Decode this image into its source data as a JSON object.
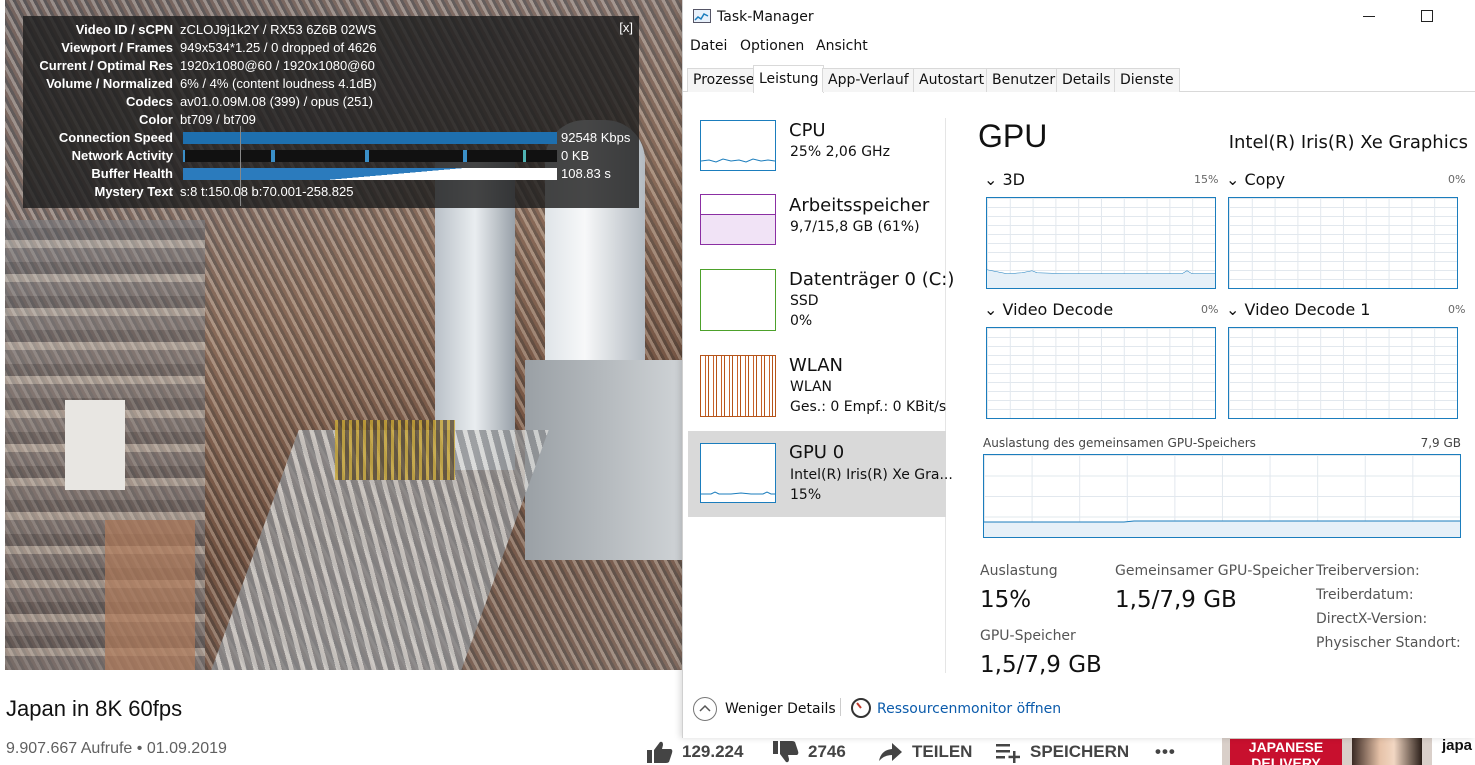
{
  "stats": {
    "close": "[x]",
    "rows": [
      {
        "label": "Video ID / sCPN",
        "value": "zCLOJ9j1k2Y / RX53 6Z6B 02WS"
      },
      {
        "label": "Viewport / Frames",
        "value": "949x534*1.25 / 0 dropped of 4626"
      },
      {
        "label": "Current / Optimal Res",
        "value": "1920x1080@60 / 1920x1080@60"
      },
      {
        "label": "Volume / Normalized",
        "value": "6% / 4% (content loudness 4.1dB)"
      },
      {
        "label": "Codecs",
        "value": "av01.0.09M.08 (399) / opus (251)"
      },
      {
        "label": "Color",
        "value": "bt709 / bt709"
      },
      {
        "label": "Connection Speed",
        "value": "92548 Kbps"
      },
      {
        "label": "Network Activity",
        "value": "0 KB"
      },
      {
        "label": "Buffer Health",
        "value": "108.83 s"
      },
      {
        "label": "Mystery Text",
        "value": "s:8 t:150.08 b:70.001-258.825"
      }
    ]
  },
  "video": {
    "title": "Japan in 8K 60fps",
    "meta": "9.907.667 Aufrufe • 01.09.2019",
    "actions": {
      "like": "129.224",
      "dislike": "2746",
      "share": "TEILEN",
      "save": "SPEICHERN",
      "more": "•••"
    }
  },
  "recommendation": {
    "thumb_text": "JAPANESE DELIVERY",
    "title": "japa"
  },
  "taskmanager": {
    "title": "Task-Manager",
    "menu": [
      "Datei",
      "Optionen",
      "Ansicht"
    ],
    "tabs": [
      "Prozesse",
      "Leistung",
      "App-Verlauf",
      "Autostart",
      "Benutzer",
      "Details",
      "Dienste"
    ],
    "active_tab": "Leistung",
    "resources": [
      {
        "name": "CPU",
        "line2": "25%  2,06 GHz",
        "line3": "",
        "color": "#1b7dbd"
      },
      {
        "name": "Arbeitsspeicher",
        "line2": "9,7/15,8 GB (61%)",
        "line3": "",
        "color": "#8b2fa3"
      },
      {
        "name": "Datenträger 0 (C:)",
        "line2": "SSD",
        "line3": "0%",
        "color": "#4da12b"
      },
      {
        "name": "WLAN",
        "line2": "WLAN",
        "line3": "Ges.: 0  Empf.: 0 KBit/s",
        "color": "#b5541a"
      },
      {
        "name": "GPU 0",
        "line2": "Intel(R) Iris(R) Xe Gra...",
        "line3": "15%",
        "color": "#1b7dbd"
      }
    ],
    "gpu": {
      "heading": "GPU",
      "model": "Intel(R) Iris(R) Xe Graphics",
      "engines": [
        {
          "label": "3D",
          "pct": "15%"
        },
        {
          "label": "Copy",
          "pct": "0%"
        },
        {
          "label": "Video Decode",
          "pct": "0%"
        },
        {
          "label": "Video Decode 1",
          "pct": "0%"
        }
      ],
      "shared_label": "Auslastung des gemeinsamen GPU-Speichers",
      "shared_max": "7,9 GB",
      "stats": {
        "util_label": "Auslastung",
        "util_value": "15%",
        "shared_mem_label": "Gemeinsamer GPU-Speicher",
        "shared_mem_value": "1,5/7,9 GB",
        "gpu_mem_label": "GPU-Speicher",
        "gpu_mem_value": "1,5/7,9 GB",
        "driver_version": "Treiberversion:",
        "driver_date": "Treiberdatum:",
        "directx": "DirectX-Version:",
        "location": "Physischer Standort:"
      }
    },
    "footer": {
      "less": "Weniger Details",
      "resmon": "Ressourcenmonitor öffnen"
    }
  }
}
